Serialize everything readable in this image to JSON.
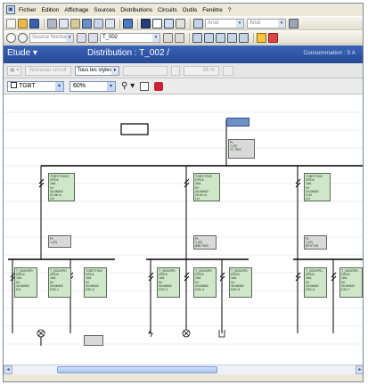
{
  "menu": {
    "items": [
      "Fichier",
      "Edition",
      "Affichage",
      "Sources",
      "Distributions",
      "Circuits",
      "Outils",
      "Fenêtre",
      "?"
    ]
  },
  "toolbar": {
    "font_combo": "Arial",
    "size_combo": "Arial"
  },
  "toolbar2": {
    "source_combo": "Source Normale",
    "dist_combo": "T_002"
  },
  "header": {
    "etude_label": "Etude",
    "distribution_label": "Distribution : T_002 /",
    "consommation": "Consommation : 5 A"
  },
  "subbar": {
    "nouveau_circuit": "Nouveau circuit",
    "styles_combo": "Tous les styles",
    "value_field": "36 m"
  },
  "viewbar": {
    "node_combo": "TGBT",
    "zoom_combo": "60%"
  },
  "colors": {
    "title_band": "#2d56a8",
    "component_fill": "#cfe6c8",
    "busbar": "#000000"
  },
  "canvas": {
    "components_top": [
      "TGBT/T002/1\nDPD4\n16A\nN+\n3G4MM2\n22.56 m\nLN",
      "TGBT/T002\nDPD4\n16A\nN+\n3G4MM2\n25.00 m\nLN",
      "TGBT/T002\nDPD4\n16A\nN+\n3G4MM2\n0.00\nLN"
    ],
    "components_mid": [
      "PL\n1 (R)",
      "PL\n1 (R)\n80B 7W3",
      "PL\n1 (R)\nEPX7VB"
    ],
    "components_bottom": [
      "T_002/DPD\nDPD4\n16A\nN+\n3G4MM2\nDS",
      "T_002/DPD\nDPD4\n16A\nN+\n3G4MM2\nDS1.1",
      "TGBT/T002\nDPD4\n16A\nN+\n3G4MM2\nDS1.2",
      "T_002/DPD\nDPD4\n16A\nN+\n3G4MM2\nDS1.3",
      "T_002/DPD\nDPD4\n16A\nN+\n3G4MM2\nDS1.4",
      "T_002/DPD\nDPD4\n16A\nN+\n3G4MM2\nDS1.5",
      "T_002/DPD\nDPD4\n16A\nN+\n3G4MM2\nDS1.6",
      "T_002/DPD\nDPD4\n16A\nN+\n3G4MM2\nDS1.7"
    ],
    "top_right_box": "PL\n1 (R)\nTL 7W3"
  }
}
